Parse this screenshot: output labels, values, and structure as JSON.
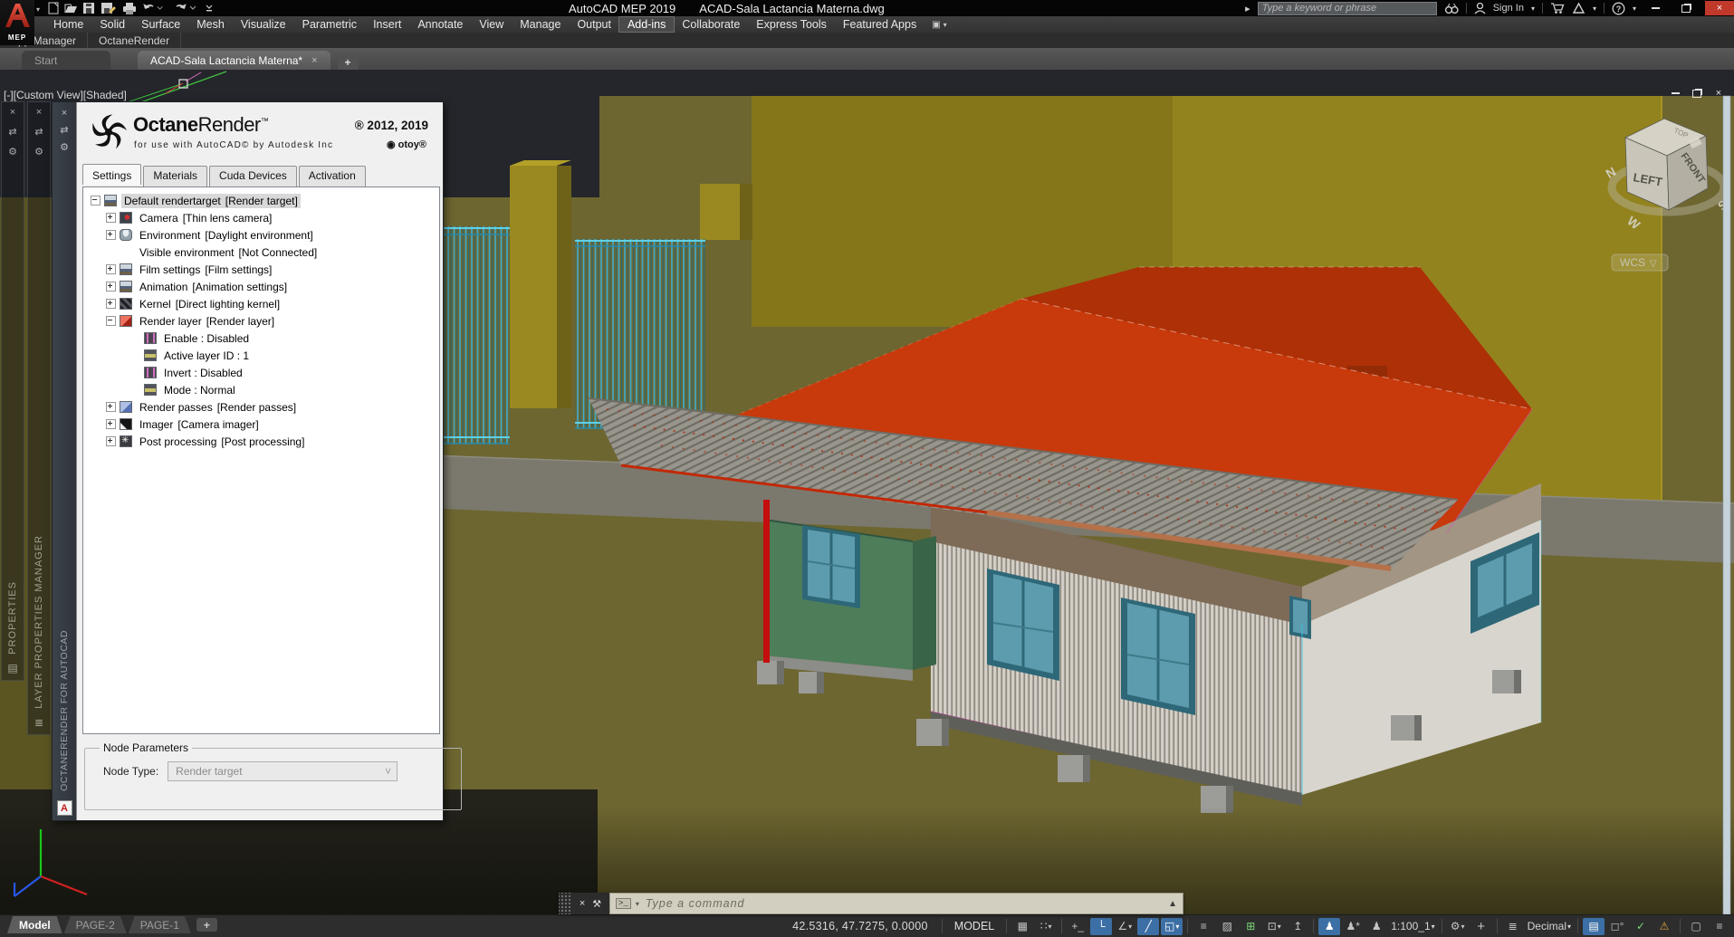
{
  "title_bar": {
    "app_title": "AutoCAD MEP 2019",
    "doc_title": "ACAD-Sala Lactancia Materna.dwg",
    "search_placeholder": "Type a keyword or phrase",
    "sign_in": "Sign In",
    "logo_badge": "MEP"
  },
  "ribbon": {
    "tabs": [
      "Home",
      "Solid",
      "Surface",
      "Mesh",
      "Visualize",
      "Parametric",
      "Insert",
      "Annotate",
      "View",
      "Manage",
      "Output",
      "Add-ins",
      "Collaborate",
      "Express Tools",
      "Featured Apps"
    ],
    "active_tab": "Add-ins",
    "panels": [
      "App Manager",
      "OctaneRender"
    ]
  },
  "file_tabs": {
    "start": "Start",
    "document": "ACAD-Sala Lactancia Materna*"
  },
  "viewport": {
    "label": "[-][Custom View][Shaded]",
    "viewcube": {
      "top": "TOP",
      "left": "LEFT",
      "front": "FRONT",
      "compass_n": "N",
      "compass_w": "W",
      "compass_s": "S",
      "wcs": "WCS"
    }
  },
  "palettes": {
    "properties": "PROPERTIES",
    "layer_manager": "LAYER PROPERTIES MANAGER"
  },
  "octane": {
    "vertical_title": "OCTANERENDER FOR AUTOCAD",
    "brand_bold": "Octane",
    "brand_light": "Render",
    "brand_tm": "™",
    "copyright": "® 2012, 2019",
    "subtitle": "for use with AutoCAD© by Autodesk Inc",
    "otoy": "◉ otoy®",
    "tabs": [
      "Settings",
      "Materials",
      "Cuda Devices",
      "Activation"
    ],
    "active_tab": "Settings",
    "tree": [
      {
        "label": "Default rendertarget",
        "detail": "[Render target]"
      },
      {
        "label": "Camera",
        "detail": "[Thin lens camera]"
      },
      {
        "label": "Environment",
        "detail": "[Daylight environment]"
      },
      {
        "label": "Visible environment",
        "detail": "[Not Connected]"
      },
      {
        "label": "Film settings",
        "detail": "[Film settings]"
      },
      {
        "label": "Animation",
        "detail": "[Animation settings]"
      },
      {
        "label": "Kernel",
        "detail": "[Direct lighting kernel]"
      },
      {
        "label": "Render layer",
        "detail": "[Render layer]"
      },
      {
        "label": "Enable : Disabled",
        "detail": ""
      },
      {
        "label": "Active layer ID : 1",
        "detail": ""
      },
      {
        "label": "Invert : Disabled",
        "detail": ""
      },
      {
        "label": "Mode : Normal",
        "detail": ""
      },
      {
        "label": "Render passes",
        "detail": "[Render passes]"
      },
      {
        "label": "Imager",
        "detail": "[Camera imager]"
      },
      {
        "label": "Post processing",
        "detail": "[Post processing]"
      }
    ],
    "node_params": {
      "legend": "Node Parameters",
      "label": "Node Type:",
      "value": "Render target"
    }
  },
  "command_line": {
    "placeholder": "Type a command"
  },
  "status_bar": {
    "layout_tabs": [
      "Model",
      "PAGE-2",
      "PAGE-1"
    ],
    "active_layout": "Model",
    "coordinates": "42.5316, 47.7275, 0.0000",
    "space_label": "MODEL",
    "icons": [
      {
        "name": "grid",
        "glyph": "▦"
      },
      {
        "name": "snap-mode",
        "glyph": "∷"
      },
      {
        "name": "dynamic-input",
        "glyph": "+_"
      },
      {
        "name": "ortho-mode",
        "glyph": "└"
      },
      {
        "name": "polar-tracking",
        "glyph": "∠"
      },
      {
        "name": "isometric-drafting",
        "glyph": "╱"
      },
      {
        "name": "object-snap",
        "glyph": "◱"
      },
      {
        "name": "lineweight",
        "glyph": "≡"
      },
      {
        "name": "transparency",
        "glyph": "▨"
      },
      {
        "name": "selection-cycling",
        "glyph": "⊞"
      },
      {
        "name": "3d-object-snap",
        "glyph": "⊡"
      },
      {
        "name": "dynamic-ucs",
        "glyph": "↥"
      },
      {
        "name": "annotation-visibility",
        "glyph": "♟"
      },
      {
        "name": "annotation-autoscale",
        "glyph": "♟*"
      },
      {
        "name": "annotation-scale",
        "glyph": "♟"
      },
      {
        "name": "scale-value",
        "text": "1:100_1"
      },
      {
        "name": "workspace-switching",
        "glyph": "⚙"
      },
      {
        "name": "annotation-monitor",
        "glyph": "+"
      },
      {
        "name": "units-ruler",
        "glyph": "≣"
      },
      {
        "name": "units-value",
        "text": "Decimal"
      },
      {
        "name": "quick-properties",
        "glyph": "▤"
      },
      {
        "name": "selection-filtering",
        "glyph": "◻°"
      },
      {
        "name": "graphics-performance",
        "glyph": "✓"
      },
      {
        "name": "hardware-acceleration",
        "glyph": "⚠"
      },
      {
        "name": "clean-screen",
        "glyph": "▢"
      },
      {
        "name": "customization",
        "glyph": "≡"
      }
    ]
  },
  "icons": {
    "caret_down": "▾",
    "caret_up": "▲",
    "wcs_caret": "▽",
    "plus": "+",
    "close": "×",
    "search_arrow": "▸",
    "prompt": "&gt;_",
    "prompt_text": ">_",
    "wrench": "⚒",
    "palette_pin": "⇄",
    "palette_gear": "⚙",
    "autocad_a": "A",
    "properties_icon": "▤",
    "layer_icon": "≣",
    "camera_tab": "▣"
  },
  "colors": {
    "accent_blue": "#3c6fa5",
    "close_red": "#c0392b",
    "roof_red": "#c8390b",
    "ground_olive": "#6d6630",
    "window_teal": "#5c9cae"
  }
}
